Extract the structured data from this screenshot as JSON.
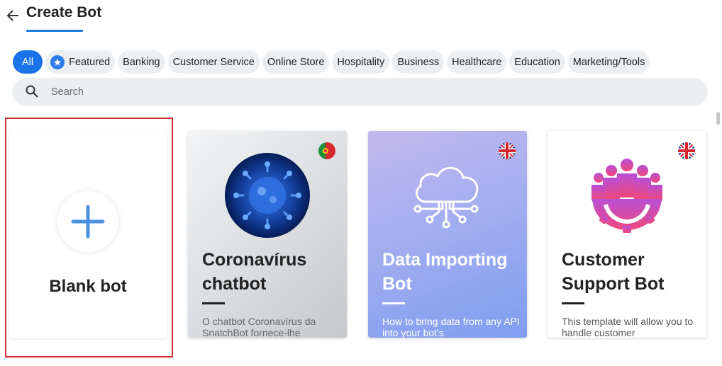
{
  "header": {
    "title": "Create Bot"
  },
  "filters": {
    "chips": [
      {
        "label": "All",
        "active": true
      },
      {
        "label": "Featured",
        "icon": "star-icon"
      },
      {
        "label": "Banking"
      },
      {
        "label": "Customer Service"
      },
      {
        "label": "Online Store"
      },
      {
        "label": "Hospitality"
      },
      {
        "label": "Business"
      },
      {
        "label": "Healthcare"
      },
      {
        "label": "Education"
      },
      {
        "label": "Marketing/Tools"
      }
    ]
  },
  "search": {
    "placeholder": "Search",
    "value": ""
  },
  "cards": {
    "blank": {
      "label": "Blank bot",
      "icon": "plus-icon"
    },
    "templates": [
      {
        "title": "Coronavírus chatbot",
        "description": "O chatbot Coronavírus da SnatchBot fornece-lhe",
        "flag": "portugal-flag-icon",
        "image": "coronavirus-icon"
      },
      {
        "title": "Data Importing Bot",
        "description": "How to bring data from any API into your bot's",
        "flag": "uk-flag-icon",
        "image": "cloud-data-icon"
      },
      {
        "title": "Customer Support Bot",
        "description": "This template will allow you to handle customer",
        "flag": "uk-flag-icon",
        "image": "team-gear-icon"
      }
    ]
  },
  "colors": {
    "accent": "#1a73e8",
    "highlight": "#d32f2f",
    "chip_bg": "#eceff1"
  }
}
